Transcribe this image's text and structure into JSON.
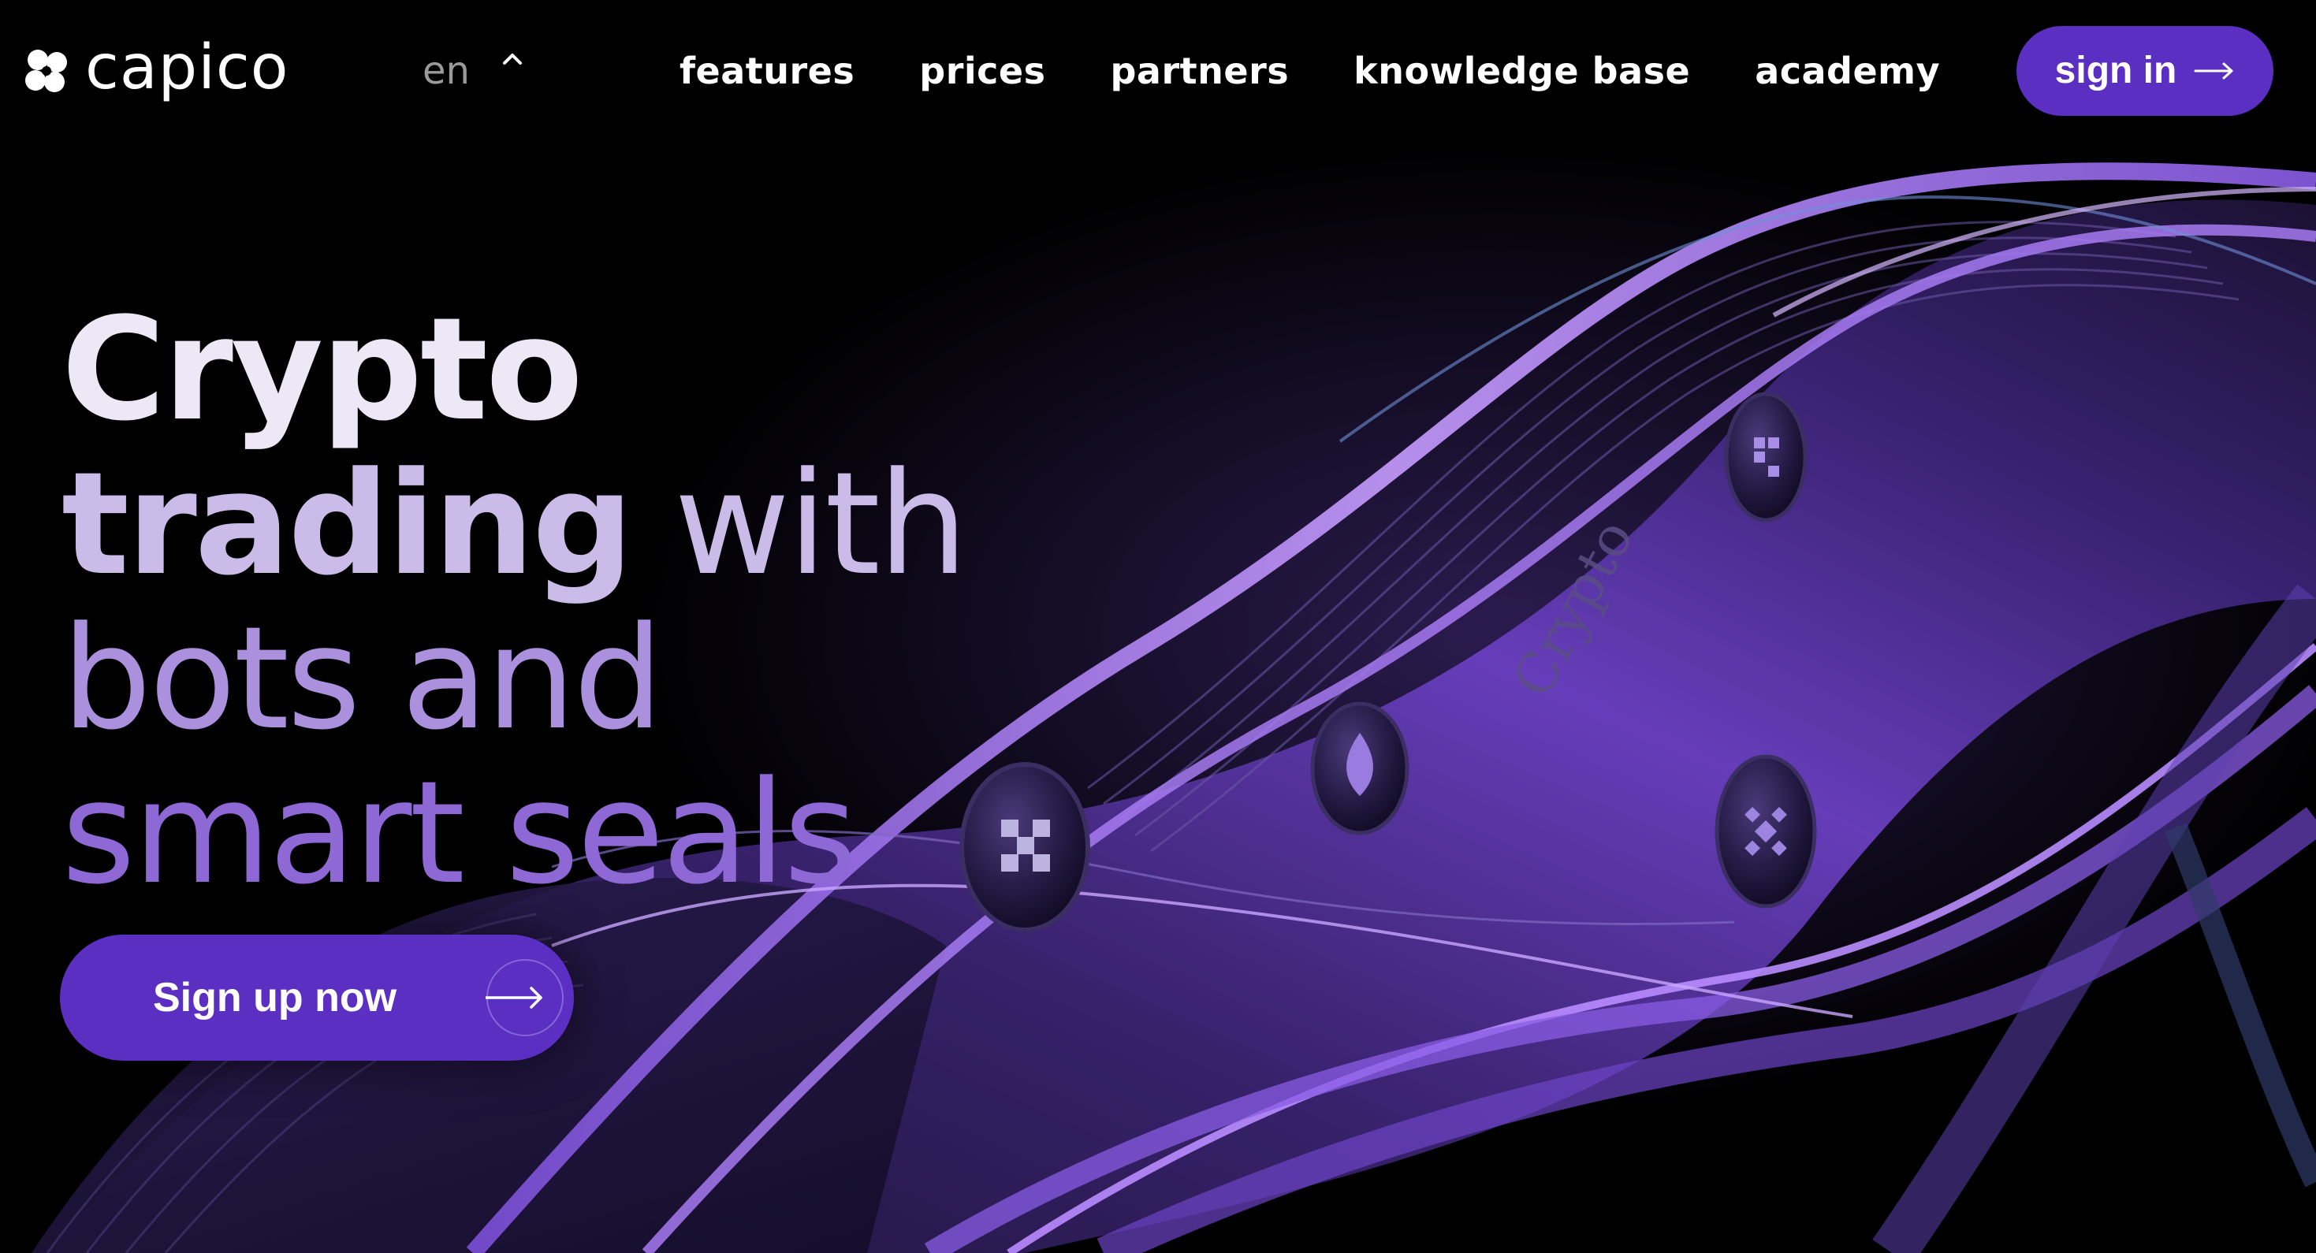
{
  "brand": {
    "name": "capico",
    "accent_color": "#5a2fc2",
    "logo_icon": "clover-logo-icon"
  },
  "header": {
    "language": {
      "selected": "en",
      "icon": "chevron-up-icon"
    },
    "nav": [
      {
        "label": "features"
      },
      {
        "label": "prices"
      },
      {
        "label": "partners"
      },
      {
        "label": "knowledge base"
      },
      {
        "label": "academy"
      }
    ],
    "signin": {
      "label": "sign in",
      "icon": "arrow-right-icon"
    }
  },
  "hero": {
    "headline": {
      "line1": "Crypto",
      "line2_a": "trading",
      "line2_b": " with",
      "line3": "bots and",
      "line4": "smart seals"
    },
    "cta": {
      "label": "Sign up now",
      "icon": "arrow-right-circle-icon"
    },
    "art": {
      "ribbon_text": "Crypto",
      "tokens": [
        "okx-token-icon",
        "flame-token-icon",
        "pixel-token-icon",
        "binance-token-icon"
      ]
    }
  }
}
